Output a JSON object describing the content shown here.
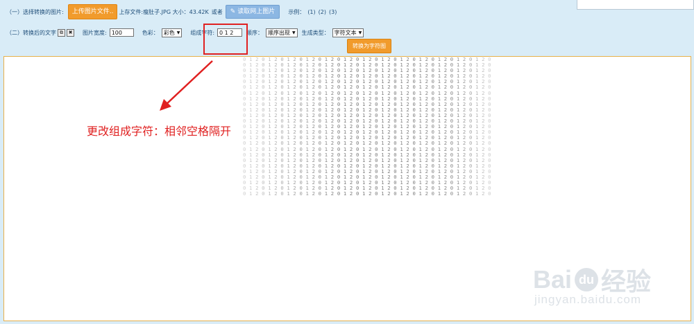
{
  "step1": {
    "label": "（一）选择转换的图片:",
    "upload_button": "上传图片文件..",
    "file_info": "上存文件:瘦肚子.JPG 大小：43.42K",
    "or_text": "或者",
    "fetch_button": "读取网上图片",
    "example_label": "示例：",
    "examples": [
      "(1)",
      "(2)",
      "(3)"
    ]
  },
  "step2": {
    "label": "（二）转换后的文字",
    "copy_icon": "copy-icon",
    "clear_icon": "close-icon",
    "width_label": "图片宽度:",
    "width_value": "100",
    "color_label": "色彩：",
    "color_value": "彩色",
    "chars_label": "组成字符:",
    "chars_value": "0 1 2",
    "order_label": "顺序：",
    "order_value": "顺序出现",
    "type_label": "生成类型：",
    "type_value": "字符文本"
  },
  "convert_button": "转换为字符图",
  "annotation": "更改组成字符：相邻空格隔开",
  "output": {
    "ascii_art": "0 1 2 0 1 2 0 1 2 0 1 2 0 1 2 0 1 2 0 1 2 0 1 2 0 1 2 0 1 2 0 1 2 0 1 2 0 1 2 0 1\n0 1 2 0 1 2 0 1 2 0 1 2 0 1 2 0 1 2 0 1 2 0 1 2 0 1 2 0 1 2 0 1 2 0 1 2 0 1 2 0 1\n0 1 2 0 1 2 0 1 2 0 1 2 0 1 2 0 1 2 0 1 2 0 1 2 0 1 2 0 1 2 0 1 2 0 1 2 0 1 2 0 1\n0 1 2 0 1 2 0 1 2 0 1 2 0 1 2 0 1 2 0 1 2 0 1 2 0 1 2 0 1 2 0 1 2 0 1 2 0 1 2 0 1\n0 1 2 0 1 2 0 1 2 0 1 2 0 1 2 0 1 2 0 1 2 0 1 2 0 1 2 0 1 2 0 1 2 0 1 2 0 1 2 0 1\n0 1 2 0 1 2 0 1 2 0 1 2 0 1 2 0 1 2 0 1 2 0 1 2 0 1 2 0 1 2 0 1 2 0 1 2 0 1 2 0 1\n0 1 2 0 1 2 0 1 2 0 1 2 0 1 2 0 1 2 0 1 2 0 1 2 0 1 2 0 1 2 0 1 2 0 1 2 0 1 2 0 1\n0 1 2 0 1 2 0 1 2 0 1 2 0 1 2 0 1 2 0 1 2 0 1 2 0 1 2 0 1 2 0 1 2 0 1 2 0 1 2 0 1\n0 1 2 0 1 2 0 1 2 0 1 2 0 1 2 0 1 2 0 1 2 0 1 2 0 1 2 0 1 2 0 1 2 0 1 2 0 1 2 0 1\n0 1 2 0 1 2 0 1 2 0 1 2 0 1 2 0 1 2 0 1 2 0 1 2 0 1 2 0 1 2 0 1 2 0 1 2 0 1 2 0 1\n0 1 2 0 1 2 0 1 2 0 1 2 0 1 2 0 1 2 0 1 2 0 1 2 0 1 2 0 1 2 0 1 2 0 1 2 0 1 2 0 1\n0 1 2 0 1 2 0 1 2 0 1 2 0 1 2 0 1 2 0 1 2 0 1 2 0 1 2 0 1 2 0 1 2 0 1 2 0 1 2 0 1\n0 1 2 0 1 2 0 1 2 0 1 2 0 1 2 0 1 2 0 1 2 0 1 2 0 1 2 0 1 2 0 1 2 0 1 2 0 1 2 0 1\n0 1 2 0 1 2 0 1 2 0 1 2 0 1 2 0 1 2 0 1 2 0 1 2 0 1 2 0 1 2 0 1 2 0 1 2 0 1 2 0 1\n0 1 2 0 1 2 0 1 2 0 1 2 0 1 2 0 1 2 0 1 2 0 1 2 0 1 2 0 1 2 0 1 2 0 1 2 0 1 2 0 1\n0 1 2 0 1 2 0 1 2 0 1 2 0 1 2 0 1 2 0 1 2 0 1 2 0 1 2 0 1 2 0 1 2 0 1 2 0 1 2 0 1\n0 1 2 0 1 2 0 1 2 0 1 2 0 1 2 0 1 2 0 1 2 0 1 2 0 1 2 0 1 2 0 1 2 0 1 2 0 1 2 0 1\n0 1 2 0 1 2 0 1 2 0 1 2 0 1 2 0 1 2 0 1 2 0 1 2 0 1 2 0 1 2 0 1 2 0 1 2 0 1 2 0 1\n0 1 2 0 1 2 0 1 2 0 1 2 0 1 2 0 1 2 0 1 2 0 1 2 0 1 2 0 1 2 0 1 2 0 1 2 0 1 2 0 1\n0 1 2 0 1 2 0 1 2 0 1 2 0 1 2 0 1 2 0 1 2 0 1 2 0 1 2 0 1 2 0 1 2 0 1 2 0 1 2 0 1\n0 1 2 0 1 2 0 1 2 0 1 2 0 1 2 0 1 2 0 1 2 0 1 2 0 1 2 0 1 2 0 1 2 0 1 2 0 1 2 0 1\n0 1 2 0 1 2 0 1 2 0 1 2 0 1 2 0 1 2 0 1 2 0 1 2 0 1 2 0 1 2 0 1 2 0 1 2 0 1 2 0 1\n0 1 2 0 1 2 0 1 2 0 1 2 0 1 2 0 1 2 0 1 2 0 1 2 0 1 2 0 1 2 0 1 2 0 1 2 0 1 2 0 1\n0 1 2 0 1 2 0 1 2 0 1 2 0 1 2 0 1 2 0 1 2 0 1 2 0 1 2 0 1 2 0 1 2 0 1 2 0 1 2 0 1\n0 1 2 0 1 2 0 1 2 0 1 2 0 1 2 0 1 2 0 1 2 0 1 2 0 1 2 0 1 2 0 1 2 0 1 2 0 1 2 0 1"
  },
  "watermark": {
    "logo_text_left": "Bai",
    "logo_text_mid": "du",
    "logo_text_right": "经验",
    "url": "jingyan.baidu.com"
  },
  "colors": {
    "background": "#d9ecf7",
    "accent_orange": "#f19b2c",
    "accent_blue": "#8cb7e3",
    "highlight_red": "#e02020"
  }
}
